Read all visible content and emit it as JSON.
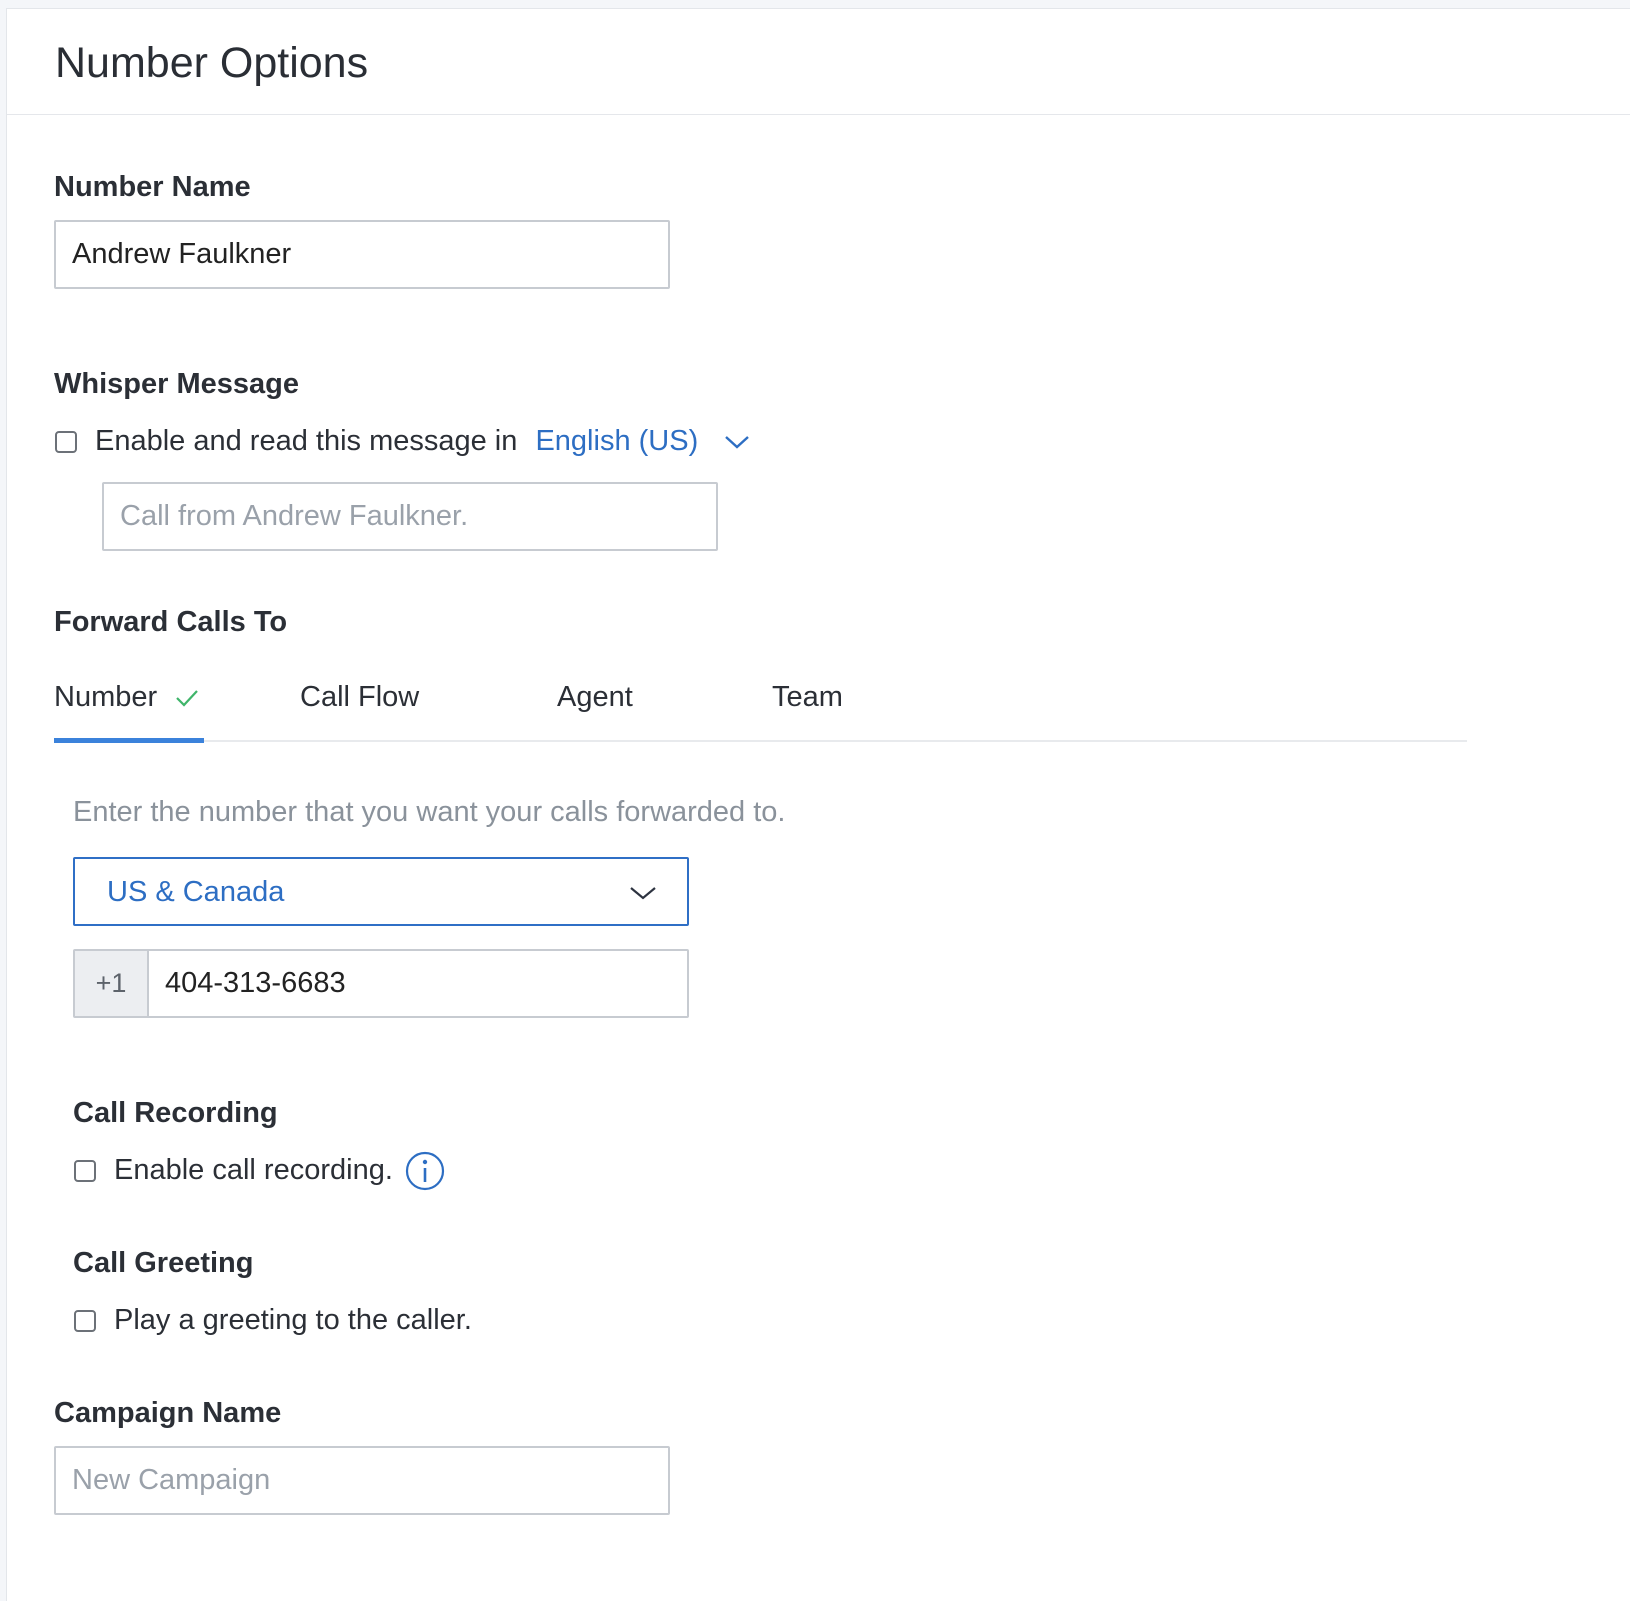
{
  "page": {
    "title": "Number Options"
  },
  "number_name": {
    "label": "Number Name",
    "value": "Andrew Faulkner"
  },
  "whisper": {
    "label": "Whisper Message",
    "checkbox_label": "Enable and read this message in",
    "checked": false,
    "language": "English (US)",
    "message_placeholder": "Call from Andrew Faulkner."
  },
  "forward": {
    "label": "Forward Calls To",
    "tabs": [
      {
        "label": "Number",
        "active": true
      },
      {
        "label": "Call Flow",
        "active": false
      },
      {
        "label": "Agent",
        "active": false
      },
      {
        "label": "Team",
        "active": false
      }
    ],
    "hint": "Enter the number that you want your calls forwarded to.",
    "region": "US & Canada",
    "country_code": "+1",
    "phone": "404-313-6683"
  },
  "call_recording": {
    "label": "Call Recording",
    "checkbox_label": "Enable call recording.",
    "checked": false,
    "info_icon": "info-icon"
  },
  "call_greeting": {
    "label": "Call Greeting",
    "checkbox_label": "Play a greeting to the caller.",
    "checked": false
  },
  "campaign": {
    "label": "Campaign Name",
    "placeholder": "New Campaign"
  },
  "colors": {
    "accent": "#3b82db",
    "link": "#2d6ec3",
    "check": "#3fb56a"
  }
}
